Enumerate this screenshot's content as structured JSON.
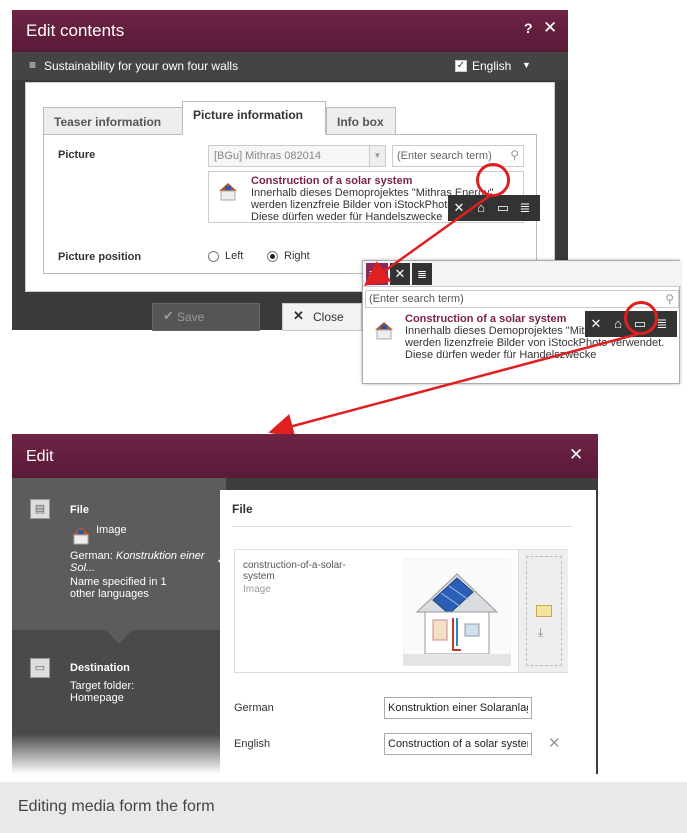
{
  "dialog1": {
    "title": "Edit contents",
    "help": "?",
    "close": "✕",
    "subtitle_icon": "≡",
    "subtitle": "Sustainability for your own four walls",
    "language": "English",
    "tabs": [
      "Teaser information",
      "Picture information",
      "Info box"
    ],
    "active_tab": "Picture information",
    "picture_label": "Picture",
    "picture_select": "[BGu] Mithras 082014",
    "search_placeholder": "(Enter search term)",
    "result_title": "Construction of a solar system",
    "result_desc": "Innerhalb dieses Demoprojektes \"Mithras Energy\" werden lizenzfreie Bilder von iStockPhoto verwendet. Diese dürfen weder für Handelszwecke",
    "position_label": "Picture position",
    "position_left": "Left",
    "position_right": "Right",
    "position_value": "Right",
    "save": "Save",
    "close_button": "Close"
  },
  "callout": {
    "search_placeholder": "(Enter search term)",
    "result_title": "Construction of a solar system",
    "result_desc": "Innerhalb dieses Demoprojektes \"Mithras Energy\" werden lizenzfreie Bilder von iStockPhoto verwendet. Diese dürfen weder für Handelszwecke"
  },
  "dialog2": {
    "title": "Edit",
    "close": "✕",
    "sidebar": {
      "file_heading": "File",
      "file_type": "Image",
      "file_german_label": "German:",
      "file_german_value": "Konstruktion einer Sol...",
      "file_note": "Name specified in 1 other languages",
      "destination_heading": "Destination",
      "destination_label": "Target folder:",
      "destination_value": "Homepage"
    },
    "main": {
      "heading": "File",
      "file_name": "construction-of-a-solar-system",
      "file_type": "Image",
      "german_label": "German",
      "german_value": "Konstruktion einer Solaranlage",
      "english_label": "English",
      "english_value": "Construction of a solar system"
    }
  },
  "caption": "Editing media form the form",
  "colors": {
    "brand": "#6e2446",
    "accent_text": "#7a1f4a",
    "highlight": "#e02020"
  }
}
